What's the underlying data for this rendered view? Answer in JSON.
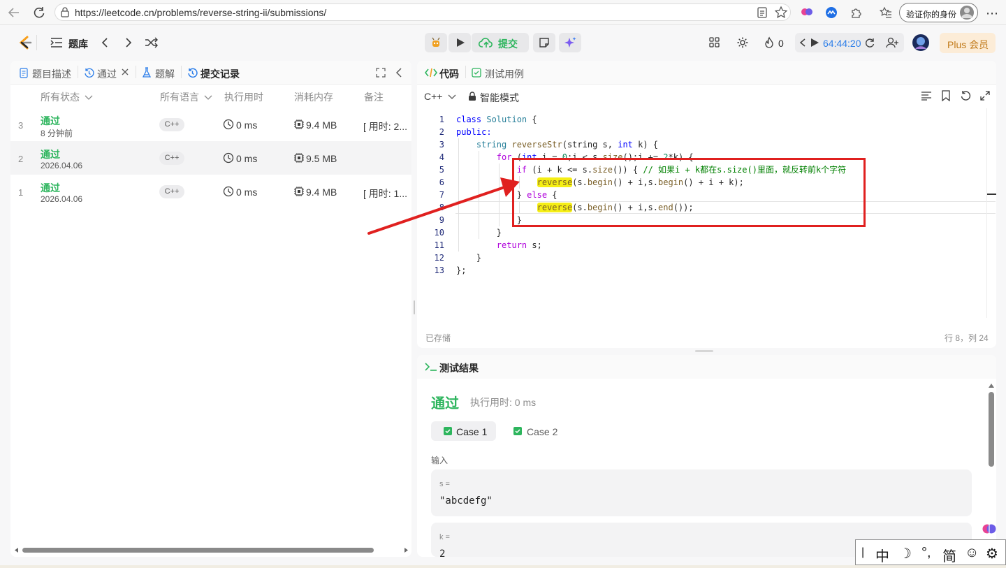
{
  "browser": {
    "url": "https://leetcode.cn/problems/reverse-string-ii/submissions/",
    "verify_label": "验证你的身份"
  },
  "header": {
    "problem_bank": "题库",
    "submit_label": "提交",
    "fire_count": "0",
    "timer": "64:44:20",
    "plus_label": "Plus 会员"
  },
  "left_tabs": {
    "description": "题目描述",
    "passed": "通过",
    "solution": "题解",
    "submissions": "提交记录"
  },
  "columns": {
    "status": "所有状态",
    "language": "所有语言",
    "runtime": "执行用时",
    "memory": "消耗内存",
    "note": "备注"
  },
  "submissions": [
    {
      "num": "3",
      "status": "通过",
      "when": "8 分钟前",
      "lang": "C++",
      "runtime": "0 ms",
      "memory": "9.4 MB",
      "note": "[ 用时: 2..."
    },
    {
      "num": "2",
      "status": "通过",
      "when": "2026.04.06",
      "lang": "C++",
      "runtime": "0 ms",
      "memory": "9.5 MB",
      "note": ""
    },
    {
      "num": "1",
      "status": "通过",
      "when": "2026.04.06",
      "lang": "C++",
      "runtime": "0 ms",
      "memory": "9.4 MB",
      "note": "[ 用时: 1..."
    }
  ],
  "editor": {
    "tab_code": "代码",
    "tab_testcase": "测试用例",
    "language": "C++",
    "mode": "智能模式",
    "saved": "已存储",
    "cursor": "行 8，列 24",
    "line_numbers": [
      "1",
      "2",
      "3",
      "4",
      "5",
      "6",
      "7",
      "8",
      "9",
      "10",
      "11",
      "12",
      "13"
    ],
    "code": {
      "l1a": "class ",
      "l1b": "Solution",
      "l1c": " {",
      "l2": "public:",
      "l3a": "    string ",
      "l3b": "reverseStr",
      "l3c": "(string s, ",
      "l3d": "int",
      "l3e": " k) {",
      "l4a": "        ",
      "l4b": "for",
      "l4c": " (",
      "l4d": "int",
      "l4e": " i = ",
      "l4f": "0",
      "l4g": ";i < s.",
      "l4h": "size",
      "l4i": "();i += ",
      "l4j": "2",
      "l4k": "*k) {",
      "l5a": "            ",
      "l5b": "if",
      "l5c": " (i + k <= s.",
      "l5d": "size",
      "l5e": "()) { ",
      "l5f": "// 如果i + k都在s.size()里面，就反转前k个字符",
      "l6a": "                ",
      "l6b": "reverse",
      "l6c": "(s.",
      "l6d": "begin",
      "l6e": "() + i,s.",
      "l6f": "begin",
      "l6g": "() + i + k);",
      "l7a": "            } ",
      "l7b": "else",
      "l7c": " {",
      "l8a": "                ",
      "l8b": "reverse",
      "l8c": "(s.",
      "l8d": "begin",
      "l8e": "() + i,s.",
      "l8f": "end",
      "l8g": "());",
      "l9": "            }",
      "l10": "        }",
      "l11a": "        ",
      "l11b": "return",
      "l11c": " s;",
      "l12": "    }",
      "l13": "};"
    }
  },
  "result": {
    "title": "测试结果",
    "status": "通过",
    "runtime_label": "执行用时: 0 ms",
    "case1": "Case 1",
    "case2": "Case 2",
    "input_label": "输入",
    "var_s": "s =",
    "val_s": "\"abcdefg\"",
    "var_k": "k =",
    "val_k": "2"
  },
  "ime": {
    "cursor": "|",
    "chinese": "中",
    "moon": "☽",
    "punct": "°,",
    "simplified": "简",
    "emoji": "☺",
    "gear": "⚙"
  },
  "colors": {
    "accent_green": "#2db55d",
    "annotation_red": "#e0201f",
    "highlight_yellow": "#f5ee15",
    "timer_blue": "#2b7de9"
  }
}
